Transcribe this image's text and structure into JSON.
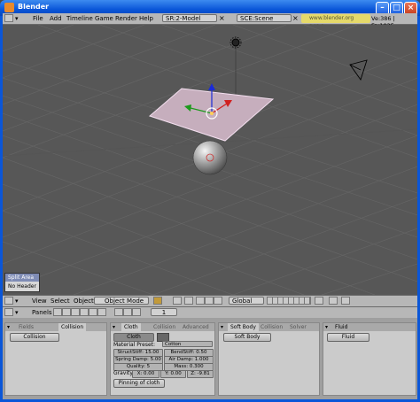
{
  "window": {
    "title": "Blender"
  },
  "info_header": {
    "menus": [
      "File",
      "Add",
      "Timeline",
      "Game",
      "Render",
      "Help"
    ],
    "screen": "SR:2-Model",
    "scene": "SCE:Scene",
    "url": "www.blender.org 248.1",
    "stats": "Ve:386 | Fa:1025"
  },
  "popup": {
    "items": [
      "Split Area",
      "No Header"
    ]
  },
  "view3d_header": {
    "menus": [
      "View",
      "Select",
      "Object"
    ],
    "mode": "Object Mode",
    "orientation": "Global"
  },
  "buttons_header": {
    "label": "Panels",
    "frame": "1"
  },
  "panels": {
    "fields": {
      "tabs": [
        "Fields",
        "Collision"
      ],
      "button": "Collision"
    },
    "cloth": {
      "tabs": [
        "Cloth",
        "Collision",
        "Advanced"
      ],
      "toggle": "Cloth",
      "material_preset_label": "Material Preset:",
      "material_preset_value": "Cotton",
      "struct_stiff": "StructStiff: 15.00",
      "bend_stiff": "BendStiff: 0.50",
      "spring_damp": "Spring Damp: 5.00",
      "air_damp": "Air Damp: 1.000",
      "quality": "Quality: 5",
      "mass": "Mass: 0.300",
      "gravity_label": "Gravity:",
      "gx": "X: 0.00",
      "gy": "Y: 0.00",
      "gz": "Z: -9.81",
      "pinning": "Pinning of cloth"
    },
    "softbody": {
      "tabs": [
        "Soft Body",
        "Collision",
        "Solver"
      ],
      "button": "Soft Body"
    },
    "fluid": {
      "tabs": [
        "Fluid"
      ],
      "button": "Fluid"
    }
  }
}
